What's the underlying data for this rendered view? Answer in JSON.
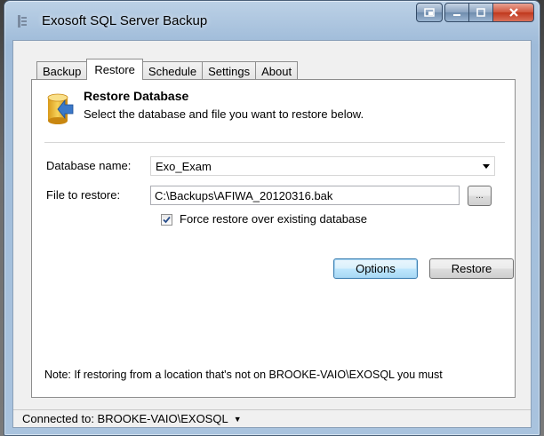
{
  "window": {
    "title": "Exosoft SQL Server Backup"
  },
  "tabs": [
    {
      "label": "Backup",
      "active": false
    },
    {
      "label": "Restore",
      "active": true
    },
    {
      "label": "Schedule",
      "active": false
    },
    {
      "label": "Settings",
      "active": false
    },
    {
      "label": "About",
      "active": false
    }
  ],
  "restore": {
    "heading": "Restore Database",
    "subheading": "Select the database and file you want to restore below.",
    "database_label": "Database name:",
    "database_value": "Exo_Exam",
    "file_label": "File to restore:",
    "file_value": "C:\\Backups\\AFIWA_20120316.bak",
    "browse_label": "...",
    "force_restore_label": "Force restore over existing database",
    "force_restore_checked": true,
    "options_label": "Options",
    "restore_label": "Restore",
    "note": "Note: If restoring from a location that's not on BROOKE-VAIO\\EXOSQL you must"
  },
  "status": {
    "connected": "Connected to: BROOKE-VAIO\\EXOSQL"
  },
  "colors": {
    "default_button_border": "#3c7fb1",
    "close_button": "#c0381d",
    "titlebar": "#a9c3de"
  }
}
